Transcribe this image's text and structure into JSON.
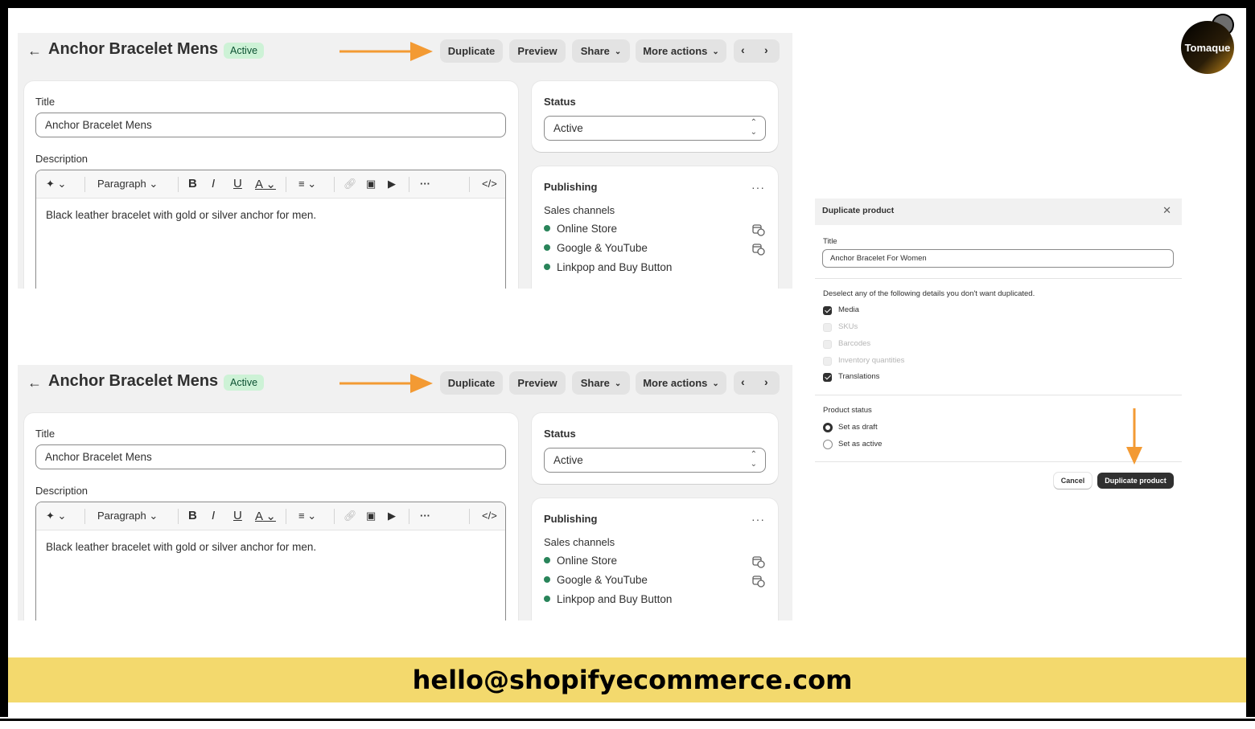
{
  "product": {
    "back_icon": "arrow-left-icon",
    "title": "Anchor Bracelet Mens",
    "badge": "Active",
    "actions": {
      "duplicate": "Duplicate",
      "preview": "Preview",
      "share": "Share",
      "more_actions": "More actions",
      "prev_icon": "chevron-left-icon",
      "next_icon": "chevron-right-icon"
    },
    "main_card": {
      "title_label": "Title",
      "title_value": "Anchor Bracelet Mens",
      "description_label": "Description",
      "toolbar": {
        "ai_icon": "sparkle-icon",
        "paragraph": "Paragraph",
        "bold": "B",
        "italic": "I",
        "underline": "U",
        "text_color": "A",
        "more": "···",
        "code": "</>"
      },
      "description_text": "Black leather bracelet with gold or silver anchor for men."
    },
    "status_card": {
      "label": "Status",
      "value": "Active"
    },
    "publishing_card": {
      "label": "Publishing",
      "channels_label": "Sales channels",
      "channels": [
        "Online Store",
        "Google & YouTube",
        "Linkpop and Buy Button"
      ]
    }
  },
  "modal": {
    "title": "Duplicate product",
    "title_label": "Title",
    "title_value": "Anchor Bracelet For Women",
    "deselect_text": "Deselect any of the following details you don't want duplicated.",
    "options": [
      {
        "label": "Media",
        "checked": true,
        "enabled": true
      },
      {
        "label": "SKUs",
        "checked": false,
        "enabled": false
      },
      {
        "label": "Barcodes",
        "checked": false,
        "enabled": false
      },
      {
        "label": "Inventory quantities",
        "checked": false,
        "enabled": false
      },
      {
        "label": "Translations",
        "checked": true,
        "enabled": true
      }
    ],
    "status_label": "Product status",
    "status_options": [
      {
        "label": "Set as draft",
        "selected": true
      },
      {
        "label": "Set as active",
        "selected": false
      }
    ],
    "cancel": "Cancel",
    "confirm": "Duplicate product"
  },
  "brand": {
    "logo_text": "Tomaque",
    "email": "hello@shopifyecommerce.com"
  },
  "colors": {
    "annotation_arrow": "#f39a33",
    "banner": "#f3d96d",
    "active_badge_bg": "#cdf2d6",
    "channel_dot": "#29845a"
  }
}
